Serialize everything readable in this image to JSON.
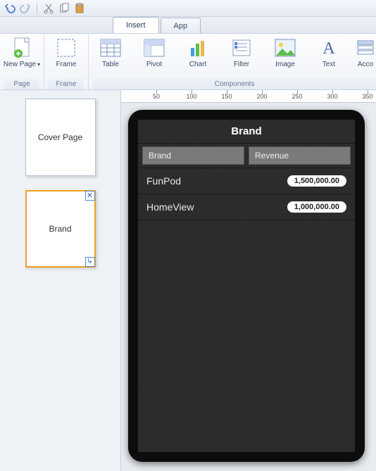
{
  "qat": {
    "undo": "undo",
    "redo": "redo",
    "cut": "cut",
    "copy": "copy",
    "paste": "paste"
  },
  "tabs": [
    "Insert",
    "App"
  ],
  "active_tab": "Insert",
  "ribbon": {
    "groups": [
      {
        "label": "Page",
        "items": [
          {
            "label": "New Page",
            "dropdown": true
          }
        ]
      },
      {
        "label": "Frame",
        "items": [
          {
            "label": "Frame"
          }
        ]
      },
      {
        "label": "Components",
        "items": [
          {
            "label": "Table"
          },
          {
            "label": "Pivot"
          },
          {
            "label": "Chart"
          },
          {
            "label": "Filter"
          },
          {
            "label": "Image"
          },
          {
            "label": "Text"
          },
          {
            "label": "Acco"
          }
        ]
      }
    ]
  },
  "pages": [
    {
      "title": "Cover Page",
      "selected": false
    },
    {
      "title": "Brand",
      "selected": true
    }
  ],
  "ruler_ticks": [
    50,
    100,
    150,
    200,
    250,
    300,
    350
  ],
  "preview": {
    "title": "Brand",
    "columns": [
      "Brand",
      "Revenue"
    ],
    "rows": [
      {
        "name": "FunPod",
        "value": "1,500,000.00"
      },
      {
        "name": "HomeView",
        "value": "1,000,000.00"
      }
    ]
  }
}
